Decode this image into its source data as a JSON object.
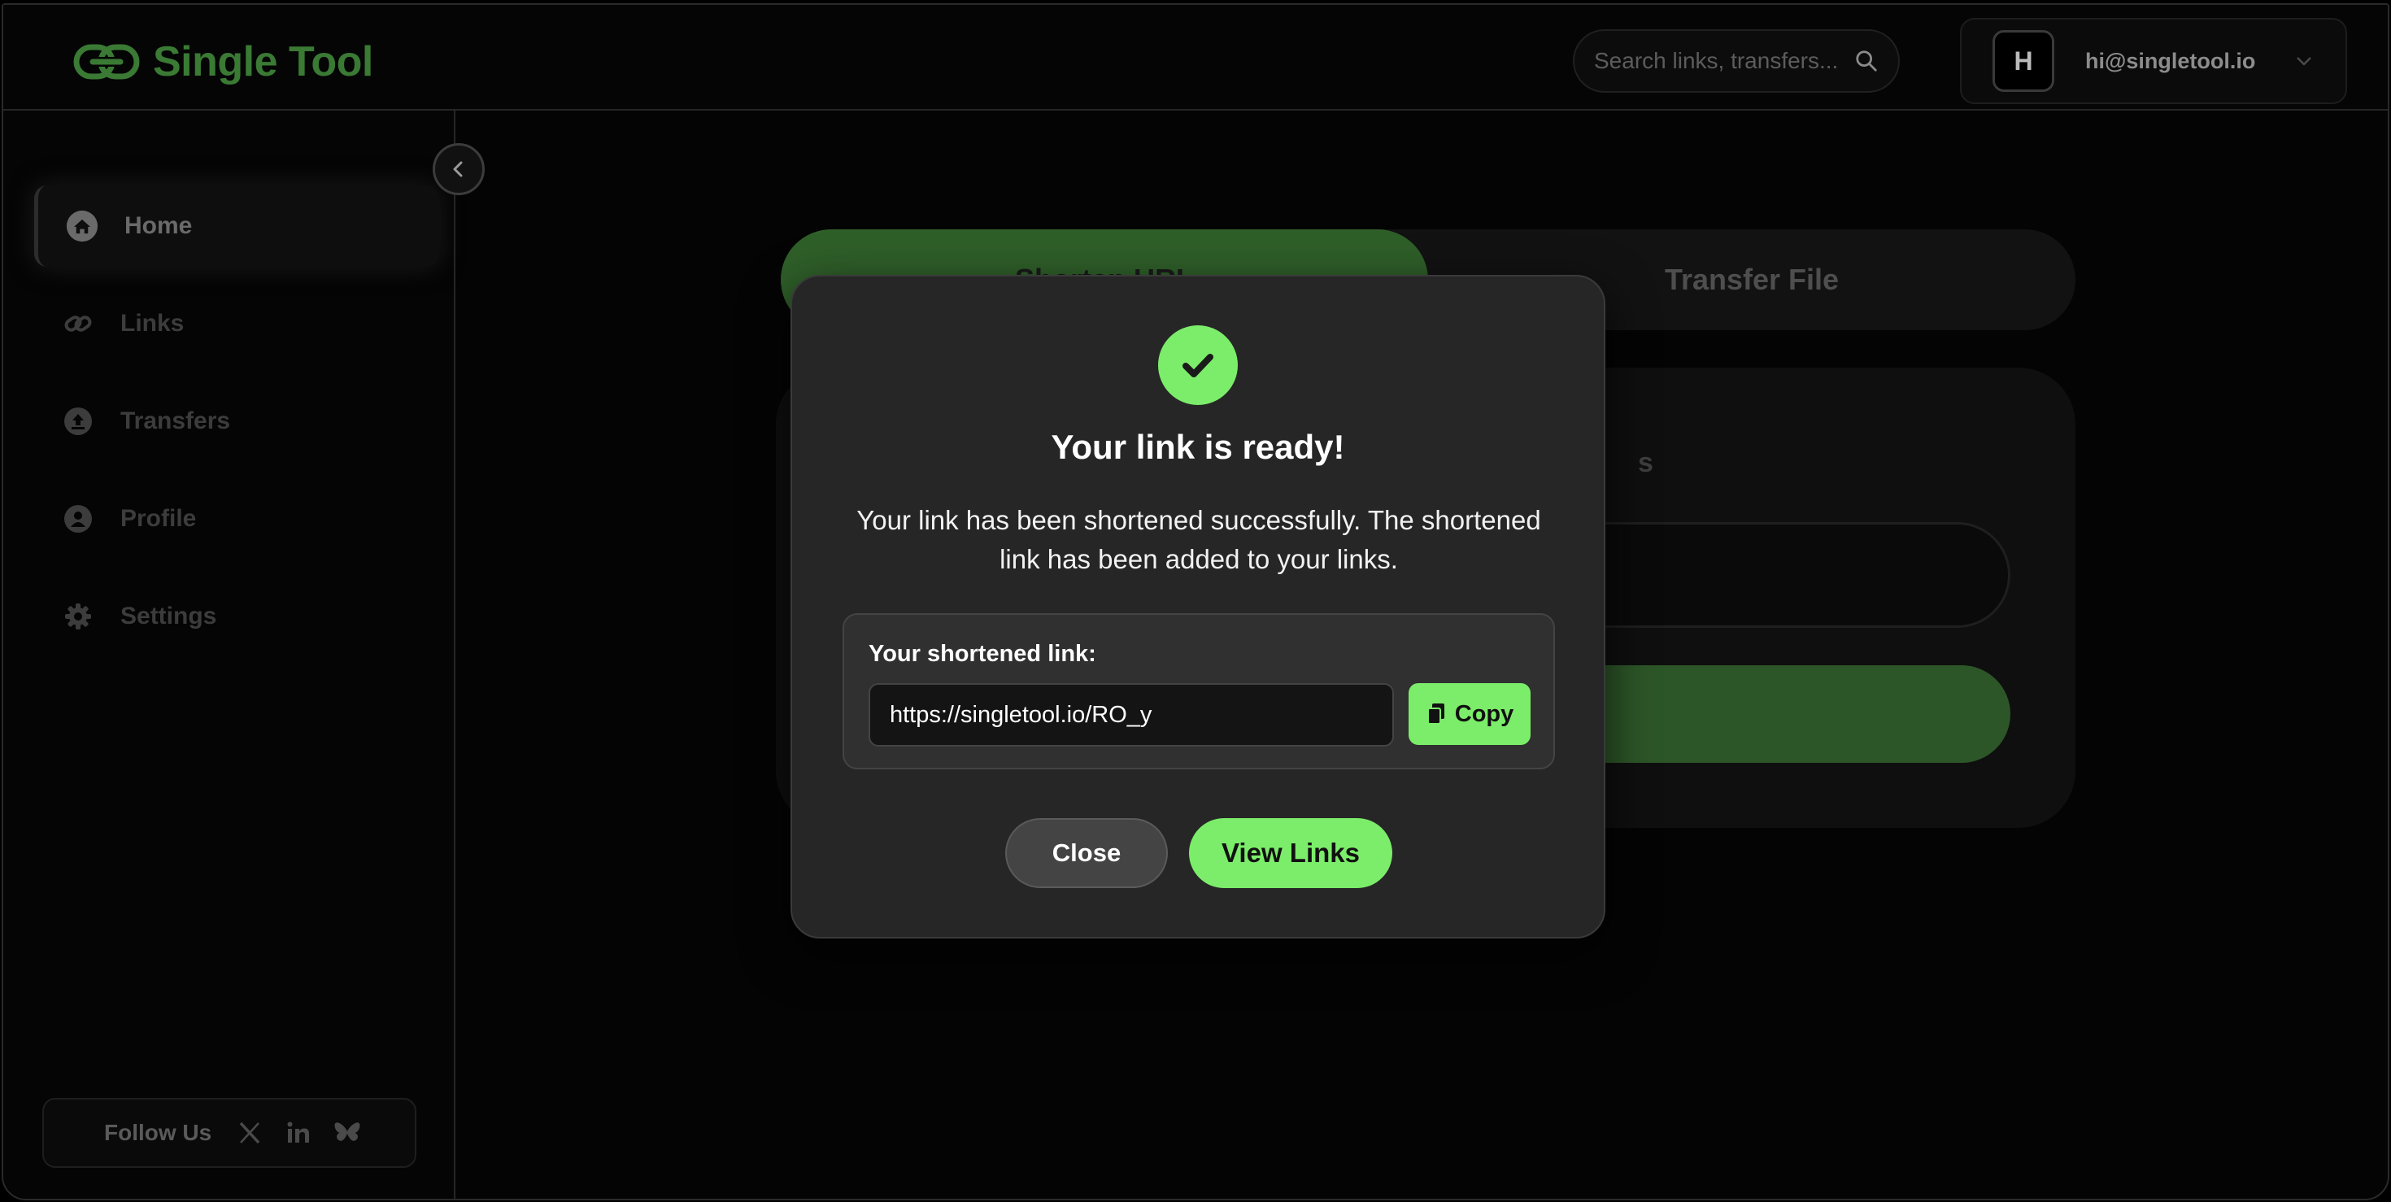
{
  "brand": {
    "name": "Single Tool",
    "accent": "#7ced6a",
    "accent_dim": "#3a7a34"
  },
  "header": {
    "search_placeholder": "Search links, transfers...",
    "user_initial": "H",
    "user_email": "hi@singletool.io"
  },
  "sidebar": {
    "items": [
      {
        "label": "Home",
        "icon": "home-icon",
        "active": true
      },
      {
        "label": "Links",
        "icon": "link-icon",
        "active": false
      },
      {
        "label": "Transfers",
        "icon": "upload-icon",
        "active": false
      },
      {
        "label": "Profile",
        "icon": "user-icon",
        "active": false
      },
      {
        "label": "Settings",
        "icon": "gear-icon",
        "active": false
      }
    ],
    "follow_label": "Follow Us",
    "socials": [
      "x-icon",
      "linkedin-icon",
      "bluesky-icon"
    ]
  },
  "main": {
    "tabs": [
      {
        "label": "Shorten URL",
        "active": true
      },
      {
        "label": "Transfer File",
        "active": false
      }
    ],
    "card_label_fragment": "s"
  },
  "modal": {
    "title": "Your link is ready!",
    "description": "Your link has been shortened successfully. The shortened link has been added to your links.",
    "link_label": "Your shortened link:",
    "link_value": "https://singletool.io/RO_y",
    "copy_label": "Copy",
    "close_label": "Close",
    "view_links_label": "View Links"
  }
}
